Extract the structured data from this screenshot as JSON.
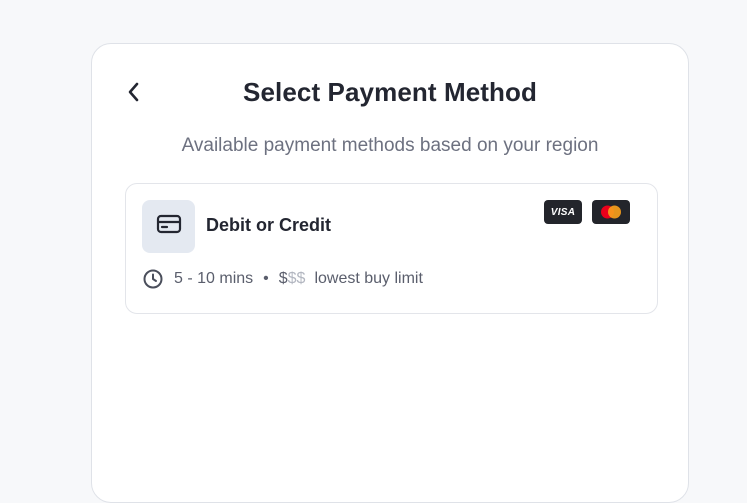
{
  "header": {
    "back_icon": "chevron-left-icon",
    "title": "Select Payment Method",
    "subtitle": "Available payment methods based on your region"
  },
  "methods": [
    {
      "icon": "credit-card-icon",
      "name": "Debit or Credit",
      "brands": [
        {
          "name": "VISA",
          "icon": "visa-logo"
        },
        {
          "name": "Mastercard",
          "icon": "mastercard-logo"
        }
      ],
      "time_icon": "clock-icon",
      "time": "5 - 10 mins",
      "separator": "•",
      "price_level_active": "$",
      "price_level_inactive": "$$",
      "limit_text": "lowest buy limit"
    }
  ],
  "colors": {
    "background": "#f7f8fa",
    "panel": "#ffffff",
    "text_primary": "#232631",
    "text_secondary": "#6d7180",
    "icon_tile": "#e4e9f1",
    "brand_badge": "#23252b",
    "mastercard_red": "#eb001b",
    "mastercard_orange": "#f79e1b"
  }
}
